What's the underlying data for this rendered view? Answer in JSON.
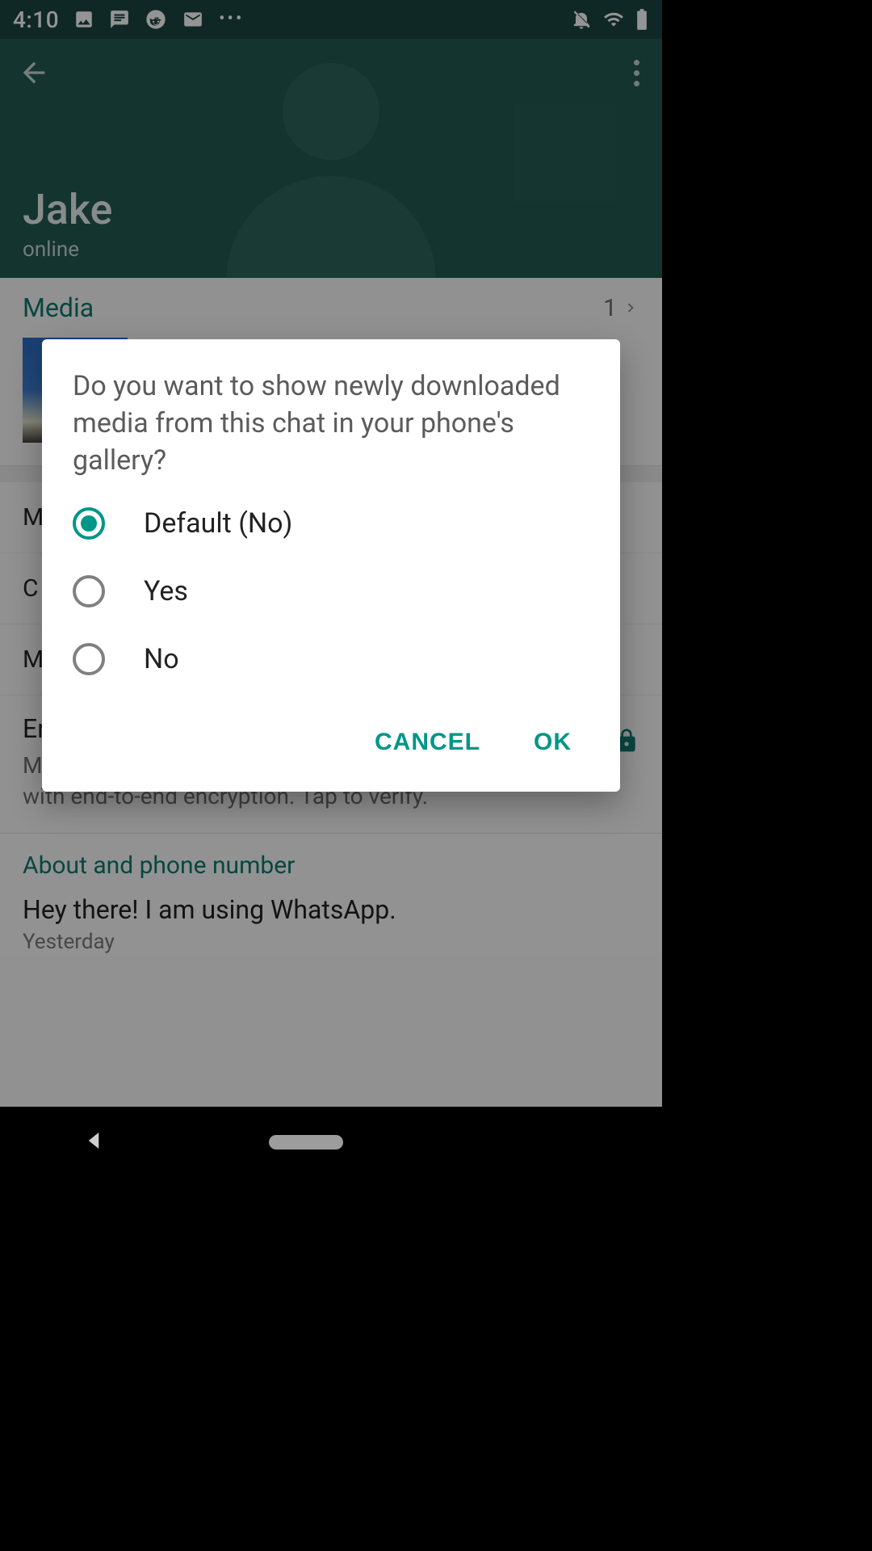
{
  "status": {
    "time": "4:10"
  },
  "header": {
    "name": "Jake",
    "status": "online"
  },
  "media": {
    "title": "Media",
    "count": "1"
  },
  "rows": {
    "mute": "M",
    "custom": "C",
    "media_vis": "M"
  },
  "encryption": {
    "title": "Encryption",
    "subtitle": "Messages to this chat and calls are secured with end-to-end encryption. Tap to verify."
  },
  "about": {
    "header": "About and phone number",
    "text": "Hey there! I am using WhatsApp.",
    "sub": "Yesterday"
  },
  "dialog": {
    "title": "Do you want to show newly downloaded media from this chat in your phone's gallery?",
    "options": [
      {
        "label": "Default (No)",
        "selected": true
      },
      {
        "label": "Yes",
        "selected": false
      },
      {
        "label": "No",
        "selected": false
      }
    ],
    "cancel": "CANCEL",
    "ok": "OK"
  }
}
